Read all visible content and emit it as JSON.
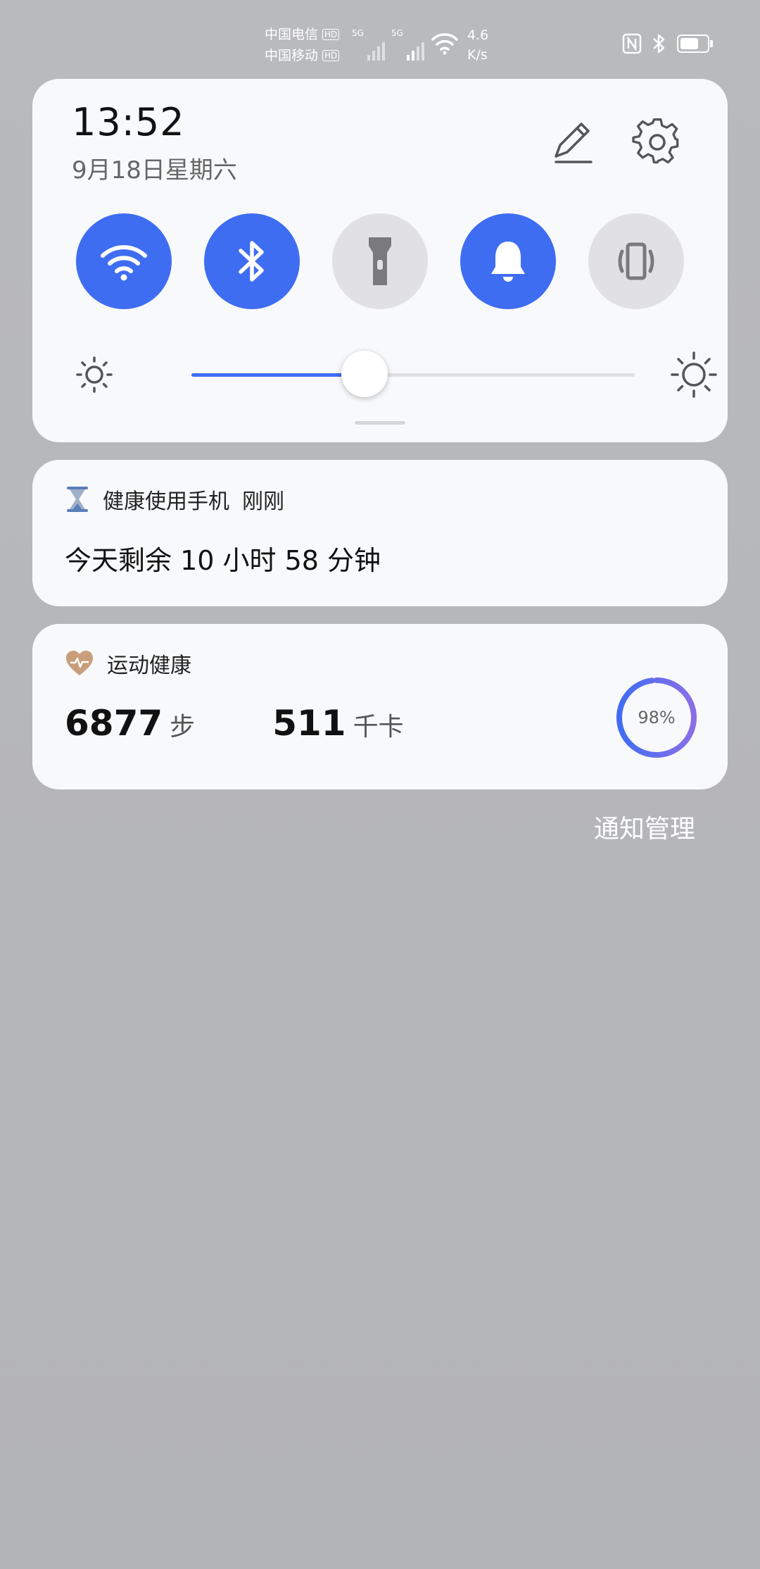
{
  "status_bar": {
    "carrier1": "中国电信",
    "carrier2": "中国移动",
    "hd_badge": "HD",
    "network_type": "5G",
    "speed_value": "4.6",
    "speed_unit": "K/s",
    "battery_level": 0.7,
    "icons": [
      "nfc-icon",
      "bluetooth-icon",
      "battery-icon"
    ]
  },
  "quick_settings": {
    "time": "13:52",
    "date": "9月18日星期六",
    "toggles": [
      {
        "name": "wifi",
        "icon": "wifi-icon",
        "on": true
      },
      {
        "name": "bluetooth",
        "icon": "bluetooth-icon",
        "on": true
      },
      {
        "name": "flashlight",
        "icon": "flashlight-icon",
        "on": false
      },
      {
        "name": "sound",
        "icon": "bell-icon",
        "on": true
      },
      {
        "name": "vibrate",
        "icon": "vibrate-icon",
        "on": false
      }
    ],
    "brightness_level": 0.39,
    "accent": "#3f6df2"
  },
  "notifications": {
    "health": {
      "app": "健康使用手机",
      "time": "刚刚",
      "body": "今天剩余 10 小时 58 分钟"
    },
    "sport": {
      "app": "运动健康",
      "steps_value": "6877",
      "steps_unit": "步",
      "cal_value": "511",
      "cal_unit": "千卡",
      "ring_label": "98%",
      "ring_value": 0.98
    }
  },
  "manage_label": "通知管理"
}
